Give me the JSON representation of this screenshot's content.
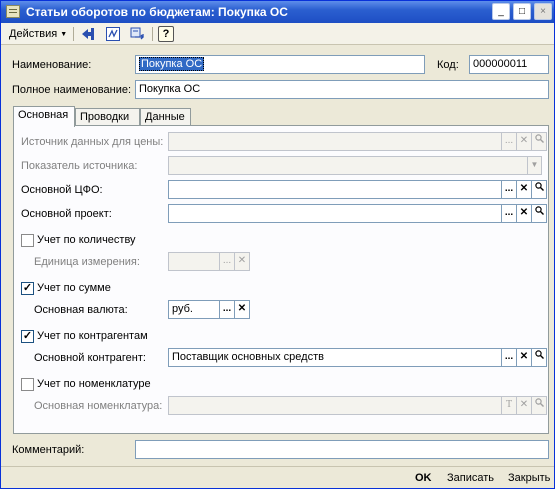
{
  "window": {
    "title": "Статьи оборотов по бюджетам: Покупка ОС",
    "minimize_glyph": "_",
    "maximize_glyph": "□",
    "close_glyph": "×"
  },
  "toolbar": {
    "actions_label": "Действия",
    "actions_arrow": "▼",
    "help_label": "?"
  },
  "header": {
    "name_label": "Наименование:",
    "name_value": "Покупка ОС",
    "code_label": "Код:",
    "code_value": "000000011",
    "fullname_label": "Полное наименование:",
    "fullname_value": "Покупка ОС"
  },
  "tabs": [
    {
      "label": "Основная",
      "active": true
    },
    {
      "label": "Проводки",
      "active": false
    },
    {
      "label": "Данные",
      "active": false
    }
  ],
  "main": {
    "price_source_label": "Источник данных для цены:",
    "price_source_value": "",
    "source_indicator_label": "Показатель источника:",
    "source_indicator_value": "",
    "cfo_label": "Основной ЦФО:",
    "cfo_value": "",
    "project_label": "Основной проект:",
    "project_value": "",
    "by_quantity_label": "Учет по количеству",
    "by_quantity_checked": false,
    "unit_label": "Единица измерения:",
    "unit_value": "",
    "by_sum_label": "Учет по сумме",
    "by_sum_checked": true,
    "currency_label": "Основная валюта:",
    "currency_value": "руб.",
    "by_contractors_label": "Учет по контрагентам",
    "by_contractors_checked": true,
    "contractor_label": "Основной контрагент:",
    "contractor_value": "Поставщик основных средств",
    "by_nomenclature_label": "Учет по номенклатуре",
    "by_nomenclature_checked": false,
    "nomenclature_label": "Основная номенклатура:",
    "nomenclature_value": ""
  },
  "footer": {
    "comment_label": "Комментарий:",
    "comment_value": "",
    "ok_label": "OK",
    "save_label": "Записать",
    "close_label": "Закрыть"
  },
  "glyphs": {
    "ellipsis": "...",
    "clear": "✕",
    "search": "🔍",
    "dropdown": "▼",
    "type": "T",
    "check": "✓"
  }
}
